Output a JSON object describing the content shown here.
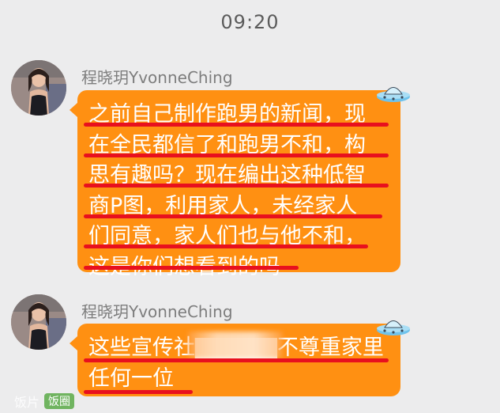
{
  "status": {
    "time": "09:20"
  },
  "messages": [
    {
      "sender": "程晓玥YvonneChing",
      "lines": [
        "之前自己制作跑男的新闻，现",
        "在全民都信了和跑男不和，构",
        "思有趣吗？现在编出这种低智",
        "商P图，利用家人，未经家人",
        "们同意，家人们也与他不和，",
        "这是你们想看到的吗"
      ]
    },
    {
      "sender": "程晓玥YvonneChing",
      "lines": [
        "这些宣传社▇▇▇▇▇不尊重家里",
        "任何一位"
      ]
    }
  ],
  "watermark": {
    "text": "饭片",
    "badge": "饭圈"
  },
  "colors": {
    "background": "#ececed",
    "bubble": "#ff9012",
    "underline": "#e8101e",
    "sender_text": "#7d7d7d"
  },
  "icons": {
    "avatar": "profile-photo",
    "bubble_decoration": "ufo-icon"
  }
}
